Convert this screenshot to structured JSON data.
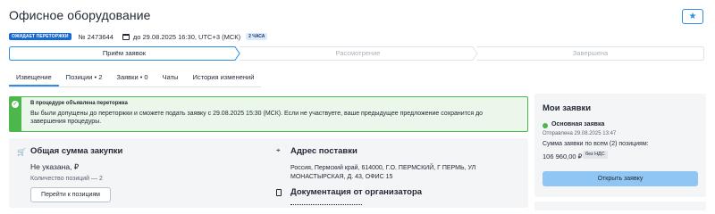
{
  "header": {
    "title": "Офисное оборудование",
    "favorite_icon": "★",
    "status_badge": "ОЖИДАЕТ ПЕРЕТОРЖКИ",
    "lot_number": "№ 2473644",
    "deadline": "до 29.08.2025 16:30, UTC+3 (МСК)",
    "hours_badge": "2 ЧАСА"
  },
  "stages": [
    {
      "label": "Приём заявок",
      "state": "active"
    },
    {
      "label": "Рассмотрение",
      "state": "inactive"
    },
    {
      "label": "Завершена",
      "state": "inactive"
    }
  ],
  "tabs": [
    {
      "label": "Извещение",
      "active": true
    },
    {
      "label": "Позиции • 2",
      "active": false
    },
    {
      "label": "Заявки • 0",
      "active": false
    },
    {
      "label": "Чаты",
      "active": false
    },
    {
      "label": "История изменений",
      "active": false
    }
  ],
  "alert": {
    "title": "В процедуре объявлена переторжка",
    "text": "Вы были допущены до переторжки и сможете подать заявку с 29.08.2025 15:30 (МСК). Если не участвуете, ваше предыдущее предложение сохранится до завершения процедуры.",
    "color": "#4cb84c"
  },
  "summary": {
    "title": "Общая сумма закупки",
    "value": "Не указана, ₽",
    "count": "Количество позиций — 2",
    "button": "Перейти к позициям"
  },
  "delivery": {
    "title": "Адрес поставки",
    "address": "Россия, Пермский край, 614000, Г.О. ПЕРМСКИЙ, Г ПЕРМЬ, УЛ МОНАСТЫРСКАЯ, Д. 43, ОФИС 15"
  },
  "docs": {
    "title": "Документация от организатора"
  },
  "my_bids": {
    "title": "Мои заявки",
    "main_label": "Основная заявка",
    "sent": "Отправлена 29.08.2025 13:47",
    "sum_all": "Сумма заявки по всем (2) позициям:",
    "price": "106 960,00 ₽",
    "vat": "без НДС",
    "button": "Открыть заявку"
  },
  "colors": {
    "accent": "#2f8de4",
    "badge": "#1769d4",
    "success": "#4cb84c",
    "button_primary": "#90c6f4"
  }
}
